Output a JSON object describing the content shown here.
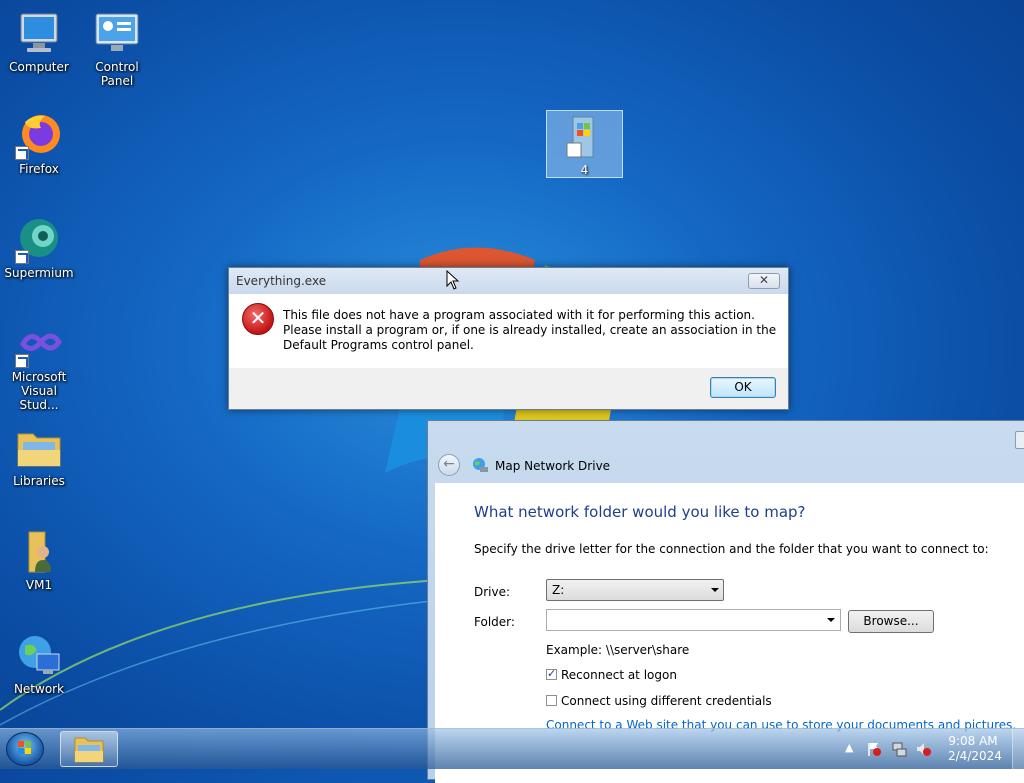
{
  "desktop": {
    "icons": [
      {
        "label": "Computer"
      },
      {
        "label": "Control Panel"
      },
      {
        "label": "Firefox"
      },
      {
        "label": "Supermium"
      },
      {
        "label": "Microsoft Visual Stud..."
      },
      {
        "label": "Libraries"
      },
      {
        "label": "VM1"
      },
      {
        "label": "Network"
      }
    ],
    "selected_icon_label": "4"
  },
  "error_dialog": {
    "title": "Everything.exe",
    "close_label": "✕",
    "message": "This file does not have a program associated with it for performing this action. Please install a program or, if one is already installed, create an association in the Default Programs control panel.",
    "ok_label": "OK"
  },
  "map_drive": {
    "title": "Map Network Drive",
    "heading": "What network folder would you like to map?",
    "instruction": "Specify the drive letter for the connection and the folder that you want to connect to:",
    "drive_label": "Drive:",
    "drive_value": "Z:",
    "folder_label": "Folder:",
    "folder_value": "",
    "browse_label": "Browse...",
    "example": "Example: \\\\server\\share",
    "reconnect_label": "Reconnect at logon",
    "reconnect_checked": true,
    "credentials_label": "Connect using different credentials",
    "credentials_checked": false,
    "link_text": "Connect to a Web site that you can use to store your documents and pictures."
  },
  "taskbar": {
    "time": "9:08 AM",
    "date": "2/4/2024",
    "tray_expand": "▲"
  }
}
